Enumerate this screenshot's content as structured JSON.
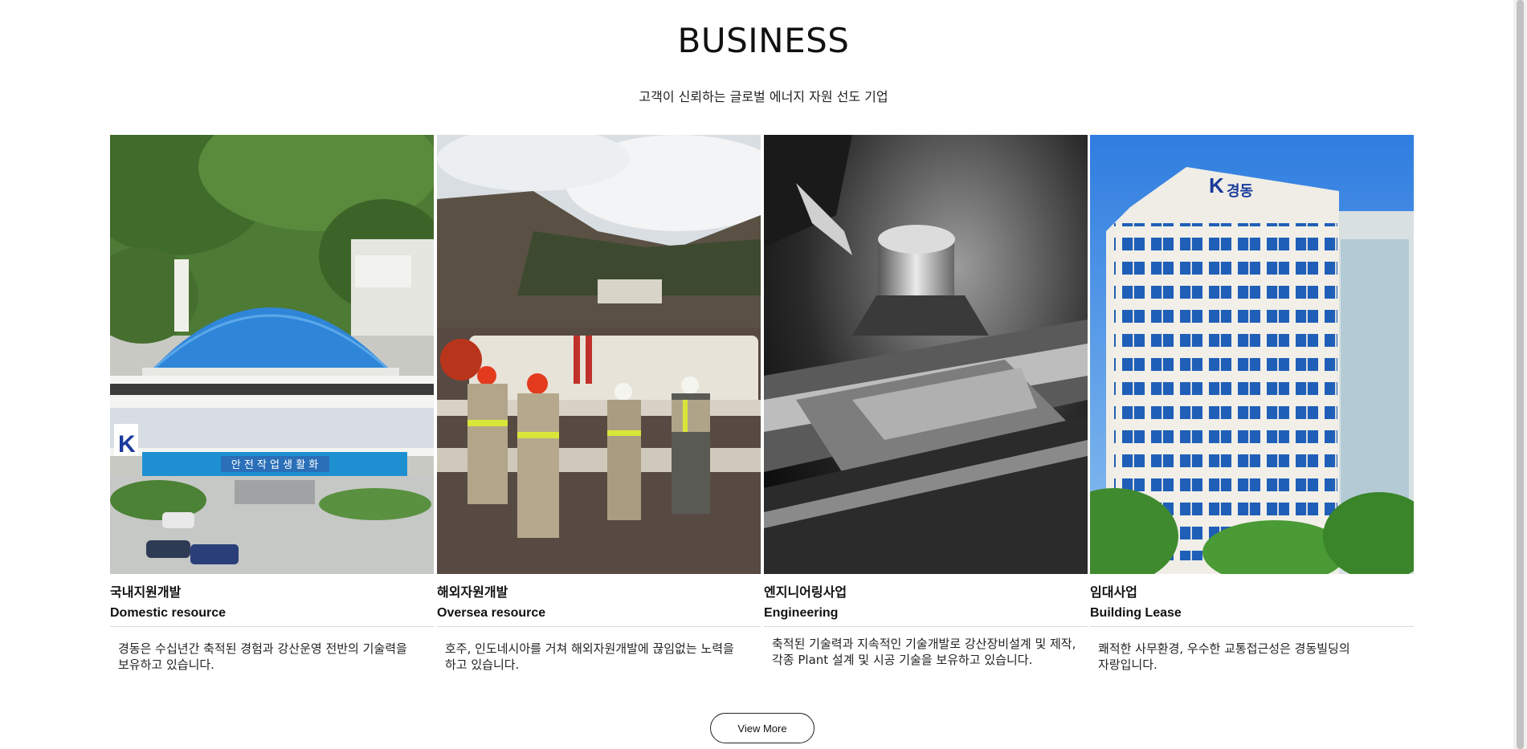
{
  "section": {
    "title": "BUSINESS",
    "subtitle": "고객이 신뢰하는 글로벌 에너지 자원 선도 기업"
  },
  "cards": [
    {
      "ko_title": "국내지원개발",
      "en_title": "Domestic resource",
      "description": "경동은 수십년간 축적된 경험과 강산운영 전반의 기술력을 보유하고 있습니다.",
      "photo_sign": "안 전 작 업 생 활 화"
    },
    {
      "ko_title": "해외자원개발",
      "en_title": "Oversea resource",
      "description": "호주, 인도네시아를 거쳐 해외자원개발에 끊임없는 노력을 하고 있습니다."
    },
    {
      "ko_title": "엔지니어링사업",
      "en_title": "Engineering",
      "description": "축적된 기술력과 지속적인 기술개발로 강산장비설계 및 제작, 각종 Plant 설계 및 시공 기술을 보유하고 있습니다."
    },
    {
      "ko_title": "임대사업",
      "en_title": "Building Lease",
      "description": "쾌적한 사무환경, 우수한 교통접근성은 경동빌딩의 자랑입니다.",
      "photo_sign": "경동"
    }
  ],
  "view_more": {
    "label": "View More"
  },
  "colors": {
    "roof_blue": "#2f86d8",
    "sky_blue": "#3d8be8",
    "text": "#111111",
    "divider": "#d9d9d9"
  }
}
